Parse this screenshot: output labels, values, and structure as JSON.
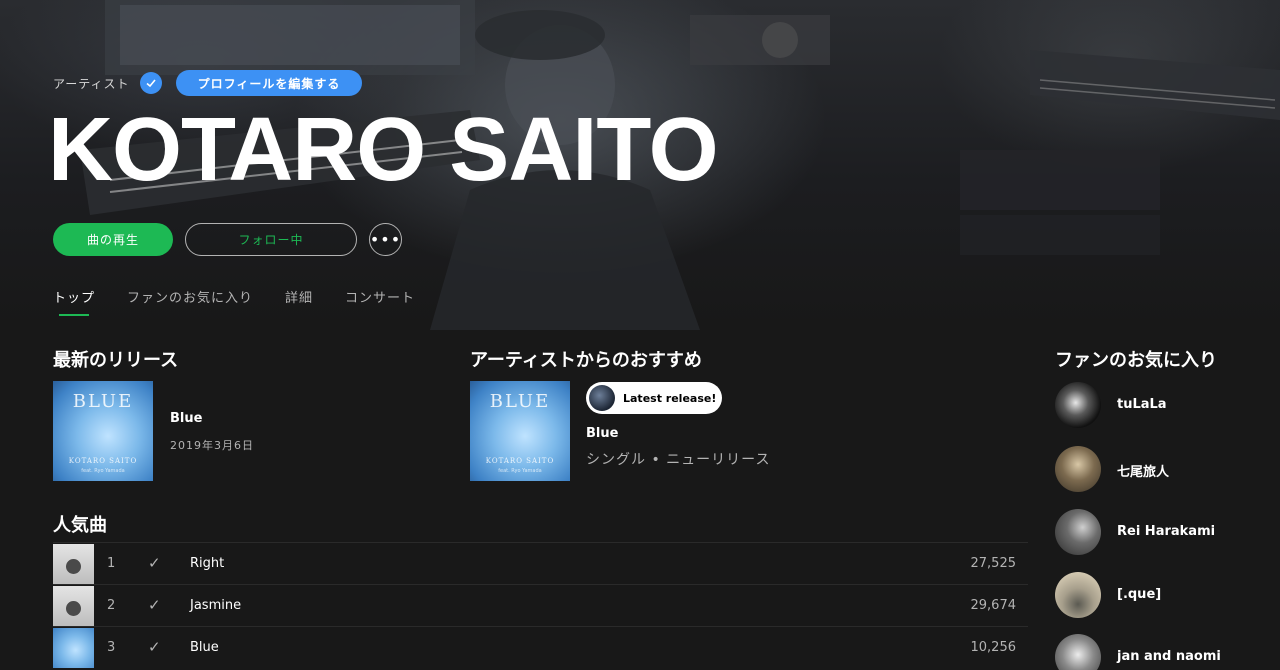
{
  "header": {
    "artist_label": "アーティスト",
    "edit_profile_label": "プロフィールを編集する",
    "artist_name": "KOTARO SAITO",
    "play_label": "曲の再生",
    "follow_label": "フォロー中",
    "more_label": "•••"
  },
  "tabs": [
    {
      "label": "トップ",
      "active": true
    },
    {
      "label": "ファンのお気に入り",
      "active": false
    },
    {
      "label": "詳細",
      "active": false
    },
    {
      "label": "コンサート",
      "active": false
    }
  ],
  "latest_release": {
    "section_title": "最新のリリース",
    "cover_title": "BLUE",
    "cover_artist": "KOTARO SAITO",
    "cover_feat": "feat. Ryo Yamada",
    "title": "Blue",
    "date": "2019年3月6日"
  },
  "artist_pick": {
    "section_title": "アーティストからのおすすめ",
    "badge": "Latest release!",
    "title": "Blue",
    "subtitle": "シングル • ニューリリース"
  },
  "popular": {
    "section_title": "人気曲",
    "tracks": [
      {
        "num": "1",
        "title": "Right",
        "plays": "27,525"
      },
      {
        "num": "2",
        "title": "Jasmine",
        "plays": "29,674"
      },
      {
        "num": "3",
        "title": "Blue",
        "plays": "10,256"
      }
    ]
  },
  "fans_like": {
    "section_title": "ファンのお気に入り",
    "artists": [
      {
        "name": "tuLaLa"
      },
      {
        "name": "七尾旅人"
      },
      {
        "name": "Rei Harakami"
      },
      {
        "name": "[.que]"
      },
      {
        "name": "jan and naomi"
      }
    ]
  },
  "colors": {
    "accent_green": "#1db954",
    "accent_blue": "#3d91f4",
    "background": "#181818"
  },
  "icons": {
    "verified": "check-badge-icon",
    "saved": "check-icon",
    "more": "ellipsis-icon"
  }
}
